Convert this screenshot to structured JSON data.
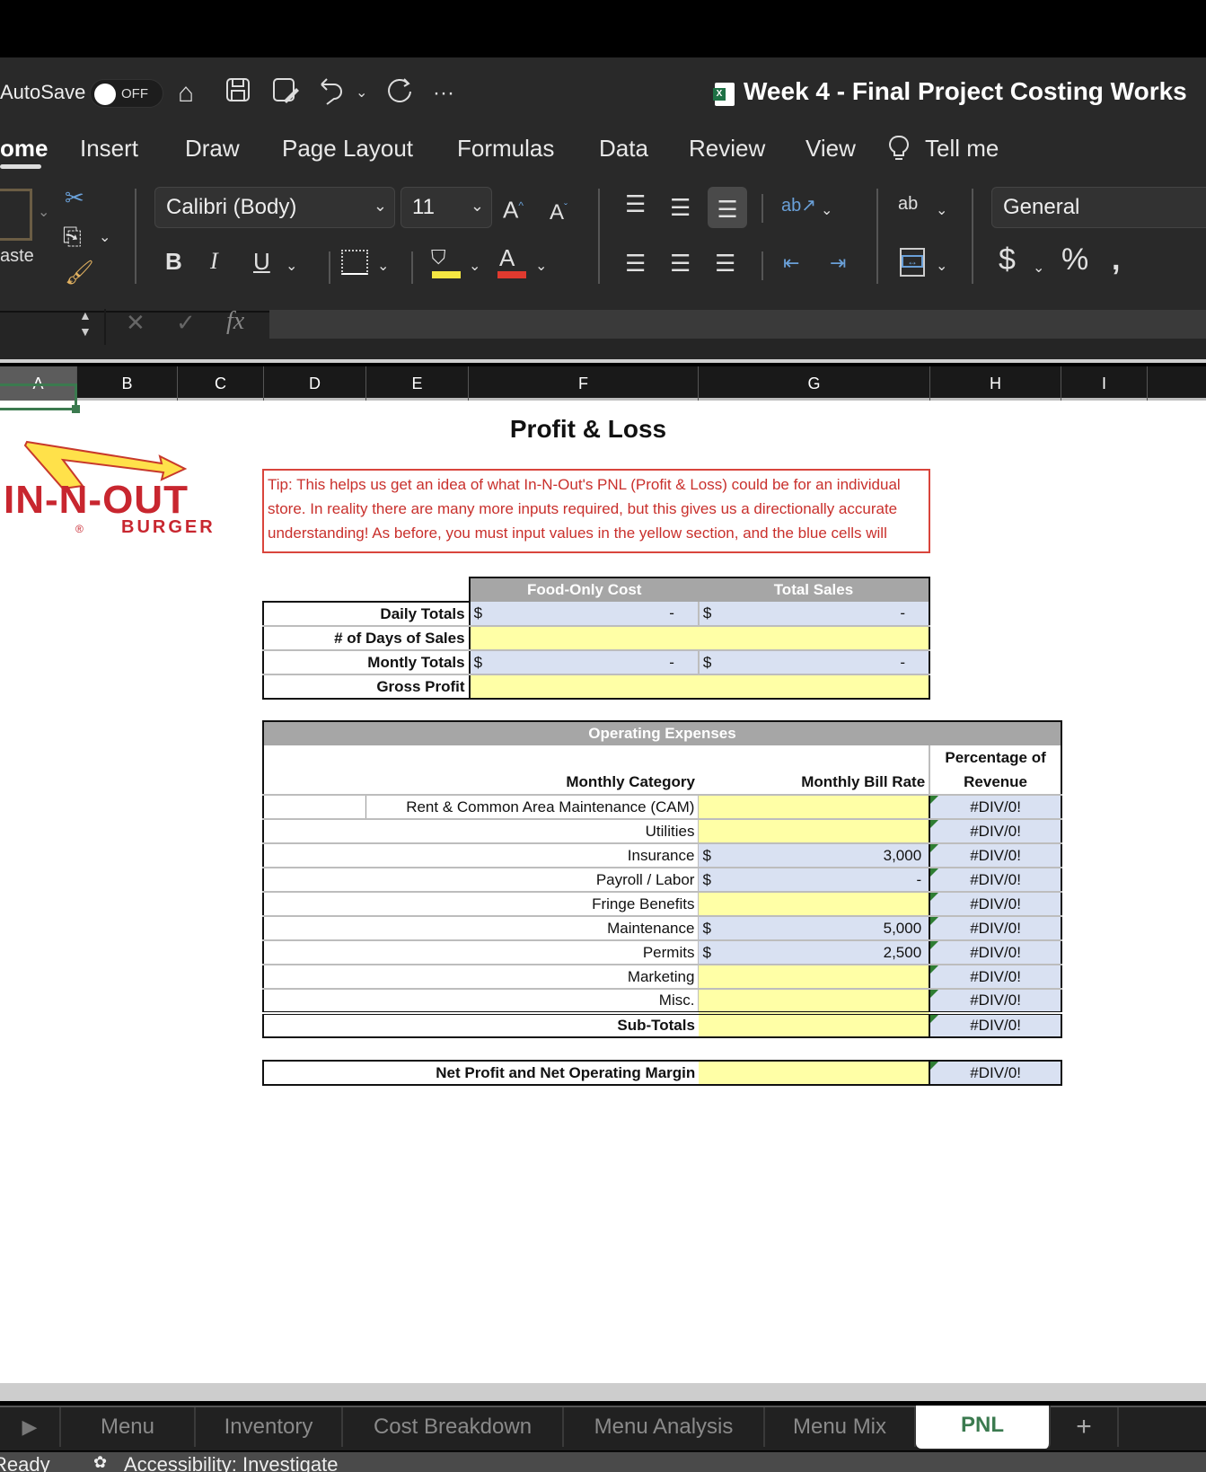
{
  "titlebar": {
    "autosave_label": "AutoSave",
    "autosave_state": "OFF",
    "document_title": "Week 4 - Final Project Costing Works",
    "more_label": "···"
  },
  "ribbon_tabs": [
    {
      "label": "ome",
      "active": true
    },
    {
      "label": "Insert"
    },
    {
      "label": "Draw"
    },
    {
      "label": "Page Layout"
    },
    {
      "label": "Formulas"
    },
    {
      "label": "Data"
    },
    {
      "label": "Review"
    },
    {
      "label": "View"
    },
    {
      "label": "Tell me"
    }
  ],
  "ribbon": {
    "paste_label": "aste",
    "font_name": "Calibri (Body)",
    "font_size": "11",
    "number_format": "General",
    "bold": "B",
    "italic": "I",
    "underline": "U",
    "accent_fill_color": "#f5e642",
    "accent_font_color": "#e03a2f"
  },
  "formula_bar": {
    "cell_ref": "",
    "cancel": "✕",
    "enter": "✓",
    "fx": "fx",
    "value": ""
  },
  "columns": [
    "A",
    "B",
    "C",
    "D",
    "E",
    "F",
    "G",
    "H",
    "I"
  ],
  "sheet": {
    "logo": {
      "line1": "IN-N-OUT",
      "line2": "BURGER",
      "reg": "®"
    },
    "title": "Profit & Loss",
    "tip": "Tip:  This helps us get an idea of what In-N-Out's PNL (Profit & Loss) could be for an individual store.  In reality there are many more inputs required, but this gives us a directionally accurate understanding!  As before, you must input values in the yellow section, and the blue cells will automatically populate.",
    "summary": {
      "headers": [
        "Food-Only Cost",
        "Total Sales"
      ],
      "rows": [
        {
          "label": "Daily Totals",
          "food_currency": "$",
          "food_value": "-",
          "sales_currency": "$",
          "sales_value": "-"
        },
        {
          "label": "# of Days of Sales"
        },
        {
          "label": "Montly Totals",
          "food_currency": "$",
          "food_value": "-",
          "sales_currency": "$",
          "sales_value": "-"
        },
        {
          "label": "Gross Profit"
        }
      ]
    },
    "opex": {
      "title": "Operating Expenses",
      "col_category": "Monthly Category",
      "col_rate": "Monthly Bill Rate",
      "col_pct_line1": "Percentage of",
      "col_pct_line2": "Revenue",
      "rows": [
        {
          "category": "Rent & Common Area Maintenance (CAM)",
          "currency": "",
          "value": "",
          "input": true,
          "pct": "#DIV/0!"
        },
        {
          "category": "Utilities",
          "currency": "",
          "value": "",
          "input": true,
          "pct": "#DIV/0!"
        },
        {
          "category": "Insurance",
          "currency": "$",
          "value": "3,000",
          "input": false,
          "pct": "#DIV/0!"
        },
        {
          "category": "Payroll / Labor",
          "currency": "$",
          "value": "-",
          "input": false,
          "pct": "#DIV/0!"
        },
        {
          "category": "Fringe Benefits",
          "currency": "",
          "value": "",
          "input": true,
          "pct": "#DIV/0!"
        },
        {
          "category": "Maintenance",
          "currency": "$",
          "value": "5,000",
          "input": false,
          "pct": "#DIV/0!"
        },
        {
          "category": "Permits",
          "currency": "$",
          "value": "2,500",
          "input": false,
          "pct": "#DIV/0!"
        },
        {
          "category": "Marketing",
          "currency": "",
          "value": "",
          "input": true,
          "pct": "#DIV/0!"
        },
        {
          "category": "Misc.",
          "currency": "",
          "value": "",
          "input": true,
          "pct": "#DIV/0!"
        }
      ],
      "subtotal_label": "Sub-Totals",
      "subtotal_pct": "#DIV/0!"
    },
    "net": {
      "label": "Net Profit and Net Operating Margin",
      "pct": "#DIV/0!"
    }
  },
  "sheet_tabs": [
    {
      "label": "Menu"
    },
    {
      "label": "Inventory"
    },
    {
      "label": "Cost Breakdown"
    },
    {
      "label": "Menu Analysis"
    },
    {
      "label": "Menu Mix"
    },
    {
      "label": "PNL",
      "active": true
    }
  ],
  "add_sheet": "+",
  "status": {
    "ready": "Ready",
    "accessibility": "Accessibility: Investigate"
  }
}
